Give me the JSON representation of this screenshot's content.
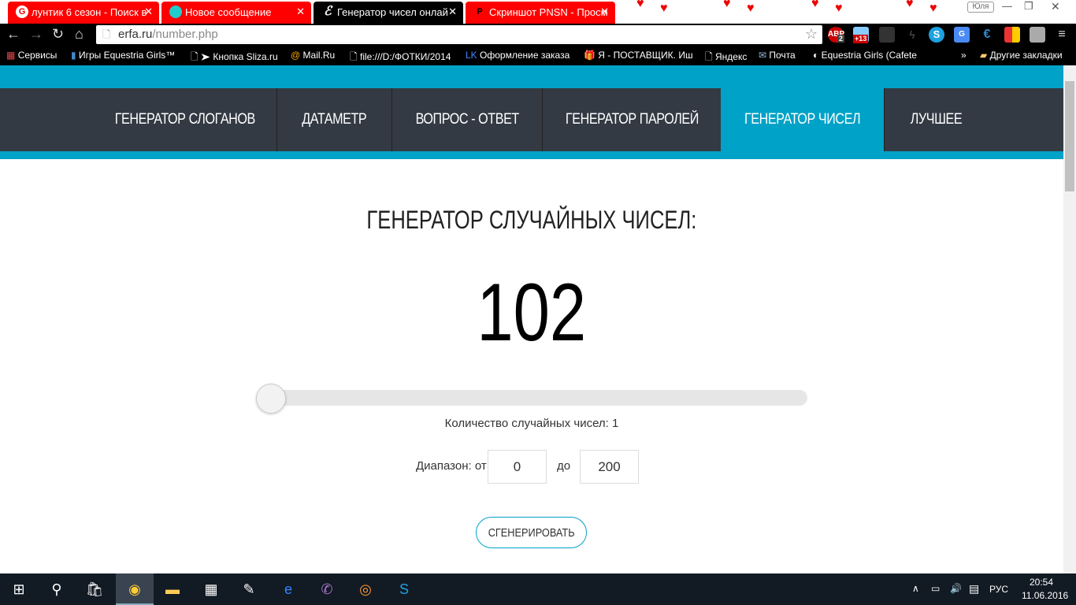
{
  "browser": {
    "tabs": [
      {
        "title": "лунтик 6 сезон - Поиск в",
        "icon": "google-icon",
        "active": false
      },
      {
        "title": "Новое сообщение",
        "icon": "mail-icon",
        "active": false
      },
      {
        "title": "Генератор чисел онлайн",
        "icon": "erfa-icon",
        "active": true
      },
      {
        "title": "Скриншот PNSN - Просм",
        "icon": "p-icon",
        "active": false
      }
    ],
    "user_label": "Юля",
    "url_host": "erfa.ru",
    "url_path": "/number.php",
    "extensions": [
      {
        "name": "adblock",
        "badge": "2"
      },
      {
        "name": "weather",
        "badge": "+13"
      }
    ],
    "bookmarks": [
      "Сервисы",
      "Игры Equestria Girls™",
      "➤ Кнопка Sliza.ru",
      "Mail.Ru",
      "file:///D:/ФОТКИ/2014",
      "Оформление заказа",
      "Я - ПОСТАВЩИК. Иш",
      "Яндекс",
      "Почта",
      "Equestria Girls (Cafete"
    ],
    "more": "»",
    "other_bookmarks": "Другие закладки"
  },
  "nav": {
    "items": [
      {
        "label": "ГЕНЕРАТОР СЛОГАНОВ",
        "active": false
      },
      {
        "label": "ДАТАМЕТР",
        "active": false
      },
      {
        "label": "ВОПРОС - ОТВЕТ",
        "active": false
      },
      {
        "label": "ГЕНЕРАТОР ПАРОЛЕЙ",
        "active": false
      },
      {
        "label": "ГЕНЕРАТОР ЧИСЕЛ",
        "active": true
      },
      {
        "label": "ЛУЧШЕЕ",
        "active": false
      }
    ]
  },
  "main": {
    "title": "ГЕНЕРАТОР СЛУЧАЙНЫХ ЧИСЕЛ:",
    "result": "102",
    "count_label": "Количество случайных чисел: 1",
    "slider_value": 1,
    "range_label": "Диапазон: от",
    "range_to_label": "до",
    "range_from": "0",
    "range_to": "200",
    "generate_button": "СГЕНЕРИРОВАТЬ"
  },
  "taskbar": {
    "lang": "РУС",
    "time": "20:54",
    "date": "11.06.2016"
  },
  "colors": {
    "accent": "#00a2c7",
    "nav_bg": "#333a44",
    "tab_red": "#ff0000"
  }
}
